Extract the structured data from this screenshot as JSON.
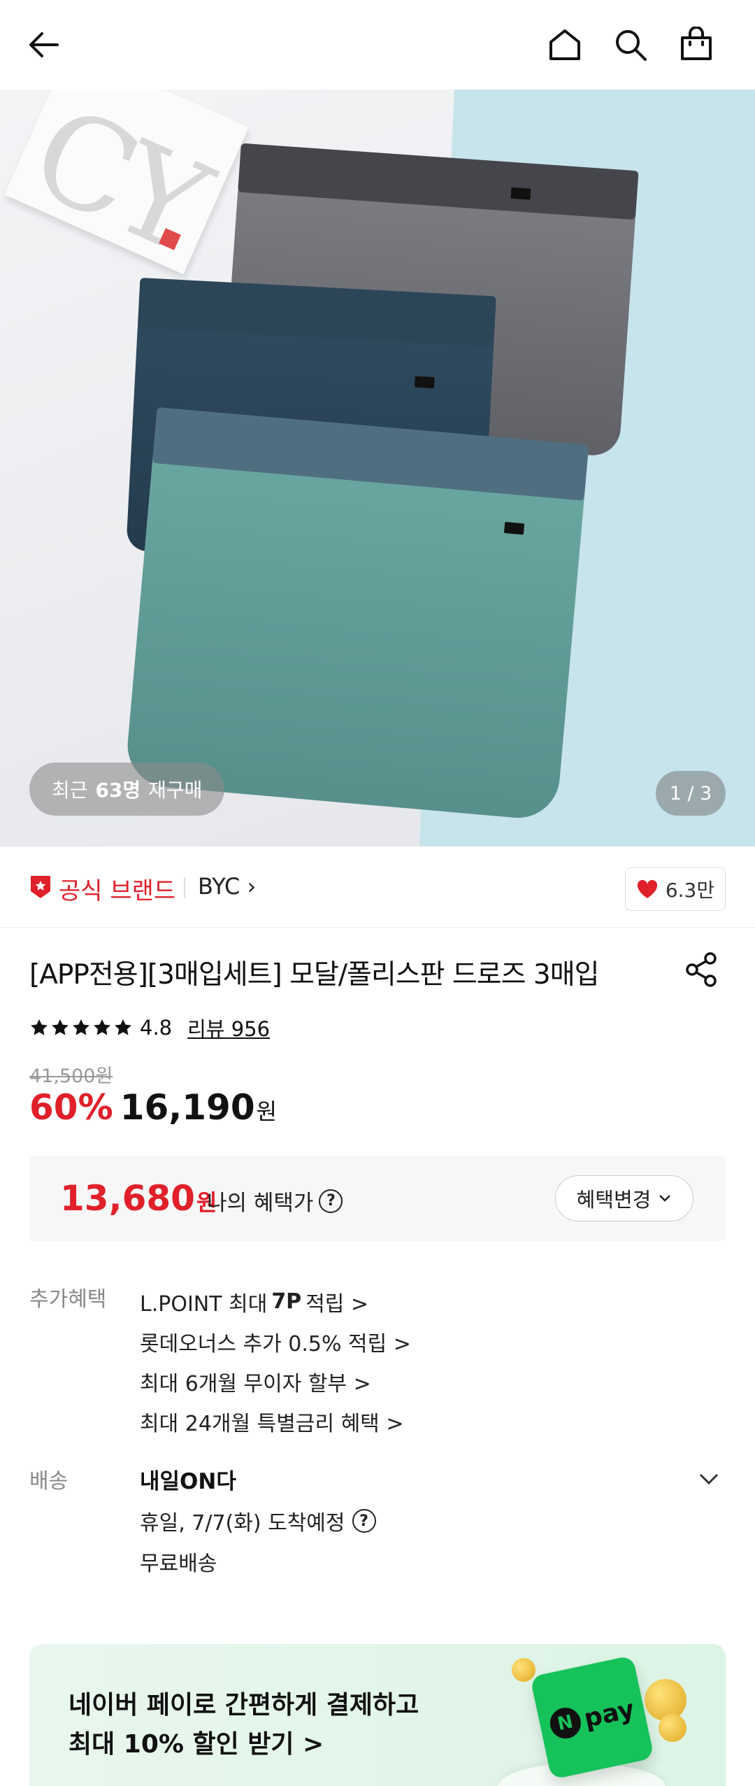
{
  "header": {
    "back_icon": "back-arrow-icon",
    "home_icon": "home-icon",
    "search_icon": "search-icon",
    "bag_icon": "shopping-bag-icon"
  },
  "hero": {
    "repurchase_prefix": "최근",
    "repurchase_count": "63명",
    "repurchase_suffix": "재구매",
    "image_counter": "1 / 3"
  },
  "brand": {
    "official_label": "공식 브랜드",
    "name": "BYC",
    "like_count": "6.3만",
    "colors": {
      "official": "#e0202a",
      "heart": "#e0202a"
    }
  },
  "product": {
    "title": "[APP전용][3매입세트] 모달/폴리스판 드로즈 3매입",
    "rating": "4.8",
    "review_label": "리뷰 956",
    "original_price": "41,500원",
    "discount": "60%",
    "sale_price": "16,190",
    "won": "원"
  },
  "my_benefit": {
    "price": "13,680",
    "won": "원",
    "label": "나의 혜택가",
    "change_button": "혜택변경"
  },
  "extra_benefits": {
    "label": "추가혜택",
    "items": [
      {
        "pre": "L.POINT 최대",
        "bold": "7P",
        "post": "적립 >"
      },
      {
        "pre": "롯데오너스 추가 0.5% 적립 >",
        "bold": "",
        "post": ""
      },
      {
        "pre": "최대 6개월 무이자 할부 >",
        "bold": "",
        "post": ""
      },
      {
        "pre": "최대 24개월 특별금리 혜택 >",
        "bold": "",
        "post": ""
      }
    ]
  },
  "shipping": {
    "label": "배송",
    "title": "내일ON다",
    "arrival": "휴일, 7/7(화) 도착예정",
    "fee": "무료배송"
  },
  "npay_banner": {
    "line1": "네이버 페이로 간편하게 결제하고",
    "line2": "최대 10% 할인 받기 >",
    "logo_text": "pay",
    "logo_n": "N",
    "brand_color": "#16c25a"
  }
}
